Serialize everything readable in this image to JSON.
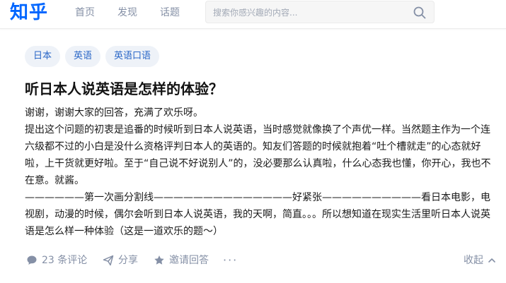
{
  "header": {
    "logo": "知乎",
    "nav": [
      "首页",
      "发现",
      "话题"
    ],
    "search_placeholder": "搜索你感兴趣的内容..."
  },
  "tags": [
    "日本",
    "英语",
    "英语口语"
  ],
  "question": {
    "title": "听日本人说英语是怎样的体验？",
    "paragraphs": [
      "谢谢，谢谢大家的回答，充满了欢乐呀。",
      "提出这个问题的初衷是追番的时候听到日本人说英语，当时感觉就像换了个声优一样。当然题主作为一个连六级都不过的小白是没什么资格评判日本人的英语的。知友们答题的时候就抱着“吐个槽就走”的心态就好啦，上干货就更好啦。至于“自己说不好说别人”的，没必要那么认真啦，什么心态我也懂，你开心，我也不在意。就酱。",
      "——————第一次画分割线——————————————好紧张——————————看日本电影，电视剧，动漫的时候，偶尔会听到日本人说英语，我的天啊，简直。。。所以想知道在现实生活里听日本人说英语是怎么样一种体验（这是一道欢乐的题～）"
    ]
  },
  "actions": {
    "comments": "23 条评论",
    "share": "分享",
    "invite": "邀请回答",
    "more": "···",
    "collapse": "收起"
  },
  "colors": {
    "brand": "#0066ff",
    "tag_bg": "#eef2f8",
    "tag_text": "#2a67c7",
    "meta_text": "#8590a6"
  },
  "icons": [
    "search-icon",
    "comment-icon",
    "share-icon",
    "invite-icon",
    "chevron-up-icon"
  ]
}
